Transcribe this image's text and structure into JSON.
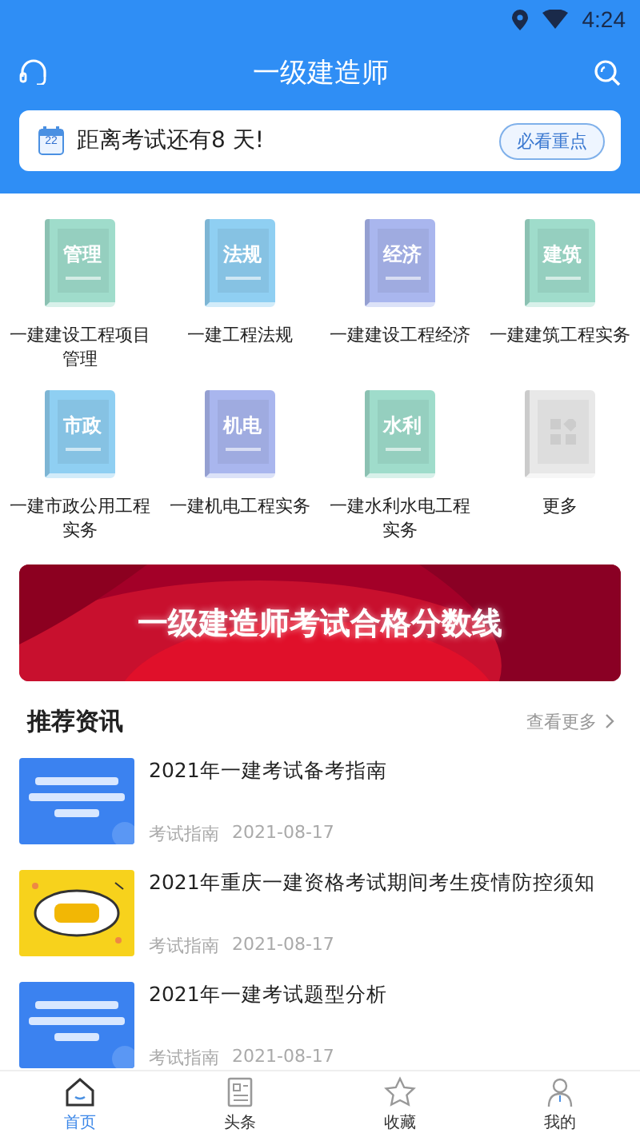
{
  "status_bar": {
    "time": "4:24"
  },
  "header": {
    "title": "一级建造师"
  },
  "countdown": {
    "calendar_day": "22",
    "text": "距离考试还有8 天!",
    "button": "必看重点"
  },
  "subjects": [
    {
      "kind": "book",
      "cover": "管理",
      "label": "一建建设工程项目管理",
      "color": "#9fdccb"
    },
    {
      "kind": "book",
      "cover": "法规",
      "label": "一建工程法规",
      "color": "#8fcff2"
    },
    {
      "kind": "book",
      "cover": "经济",
      "label": "一建建设工程经济",
      "color": "#a9b6ee"
    },
    {
      "kind": "book",
      "cover": "建筑",
      "label": "一建建筑工程实务",
      "color": "#9fdccb"
    },
    {
      "kind": "book",
      "cover": "市政",
      "label": "一建市政公用工程实务",
      "color": "#8fcff2"
    },
    {
      "kind": "book",
      "cover": "机电",
      "label": "一建机电工程实务",
      "color": "#a9b6ee"
    },
    {
      "kind": "book",
      "cover": "水利",
      "label": "一建水利水电工程实务",
      "color": "#9fdccb"
    },
    {
      "kind": "more",
      "label": "更多",
      "color": "#e8e8e8"
    }
  ],
  "banner": {
    "text": "一级建造师考试合格分数线"
  },
  "news": {
    "title": "推荐资讯",
    "more": "查看更多",
    "items": [
      {
        "title": "2021年一建考试备考指南",
        "category": "考试指南",
        "date": "2021-08-17"
      },
      {
        "title": "2021年重庆一建资格考试期间考生疫情防控须知",
        "category": "考试指南",
        "date": "2021-08-17"
      },
      {
        "title": "2021年一建考试题型分析",
        "category": "考试指南",
        "date": "2021-08-17"
      }
    ]
  },
  "tabs": [
    {
      "label": "首页",
      "selected": true
    },
    {
      "label": "头条",
      "selected": false
    },
    {
      "label": "收藏",
      "selected": false
    },
    {
      "label": "我的",
      "selected": false
    }
  ]
}
